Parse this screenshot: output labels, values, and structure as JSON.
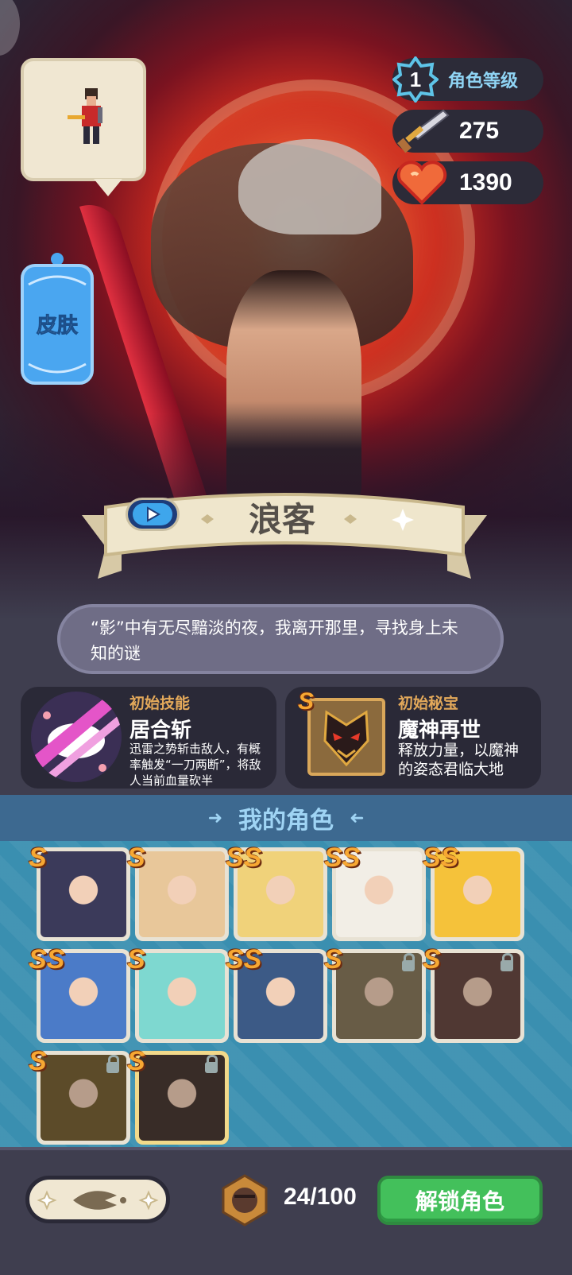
{
  "stats": {
    "level": "1",
    "level_label": "角色等级",
    "attack": "275",
    "hp": "1390"
  },
  "skin_label": "皮肤",
  "hero": {
    "name": "浪客",
    "quote": "“影”中有无尽黯淡的夜，我离开那里，寻找身上未知的谜"
  },
  "skill": {
    "tag": "初始技能",
    "name": "居合斩",
    "desc": "迅雷之势斩击敌人，有概率触发“一刀两断”，将敌人当前血量砍半"
  },
  "relic": {
    "tag": "初始秘宝",
    "name": "魔神再世",
    "desc": "释放力量，以魔神的姿态君临大地",
    "rank": "S"
  },
  "my_characters": {
    "title": "我的角色",
    "roster": [
      {
        "rank": "S",
        "locked": false,
        "color": "#3b3a5a"
      },
      {
        "rank": "S",
        "locked": false,
        "color": "#e8c79a"
      },
      {
        "rank": "SS",
        "locked": false,
        "color": "#f0d27a"
      },
      {
        "rank": "SS",
        "locked": false,
        "color": "#f2eee6"
      },
      {
        "rank": "SS",
        "locked": false,
        "color": "#f5c23a"
      },
      {
        "rank": "SS",
        "locked": false,
        "color": "#4b7bc8"
      },
      {
        "rank": "S",
        "locked": false,
        "color": "#7ed8d0"
      },
      {
        "rank": "SS",
        "locked": false,
        "color": "#3c5a86"
      },
      {
        "rank": "S",
        "locked": true,
        "color": "#8a7a5e"
      },
      {
        "rank": "S",
        "locked": true,
        "color": "#6a4a44"
      },
      {
        "rank": "S",
        "locked": true,
        "color": "#7a6436"
      },
      {
        "rank": "S",
        "locked": true,
        "color": "#4a3a34"
      }
    ]
  },
  "footer": {
    "count": "24/100",
    "unlock_label": "解锁角色"
  }
}
